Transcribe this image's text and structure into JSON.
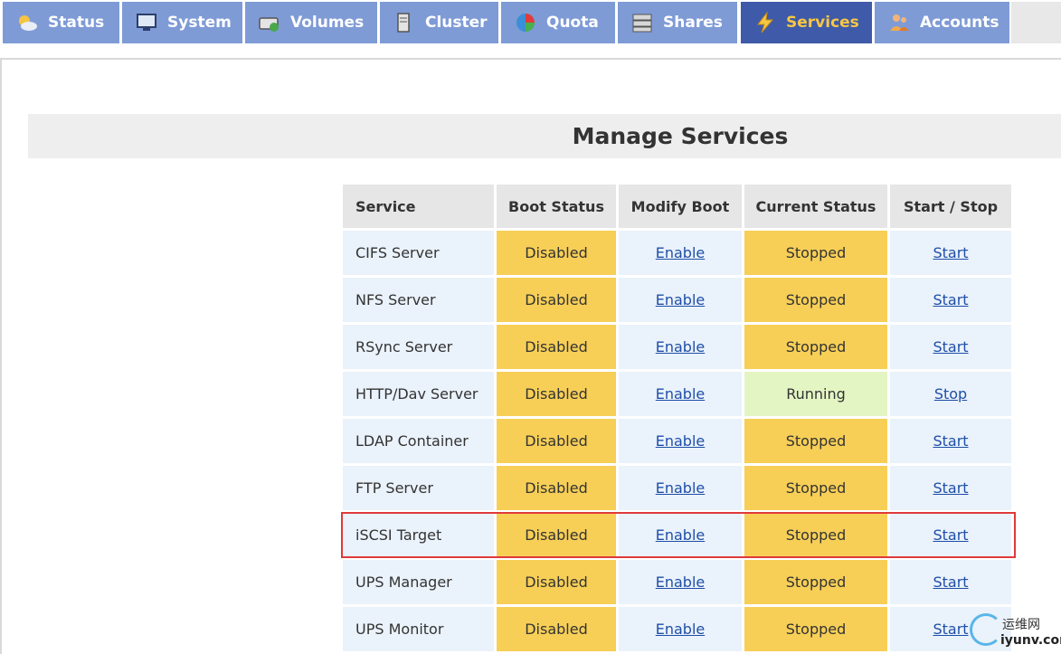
{
  "nav": {
    "tabs": [
      {
        "label": "Status",
        "icon": "weather-sun-icon"
      },
      {
        "label": "System",
        "icon": "monitor-icon"
      },
      {
        "label": "Volumes",
        "icon": "drive-icon"
      },
      {
        "label": "Cluster",
        "icon": "server-icon"
      },
      {
        "label": "Quota",
        "icon": "pie-chart-icon"
      },
      {
        "label": "Shares",
        "icon": "storage-icon"
      },
      {
        "label": "Services",
        "icon": "lightning-icon",
        "active": true
      },
      {
        "label": "Accounts",
        "icon": "users-icon"
      }
    ]
  },
  "page": {
    "title": "Manage Services"
  },
  "table": {
    "headers": [
      "Service",
      "Boot Status",
      "Modify Boot",
      "Current Status",
      "Start / Stop"
    ],
    "rows": [
      {
        "service": "CIFS Server",
        "boot": "Disabled",
        "modify": "Enable",
        "current": "Stopped",
        "action": "Start"
      },
      {
        "service": "NFS Server",
        "boot": "Disabled",
        "modify": "Enable",
        "current": "Stopped",
        "action": "Start"
      },
      {
        "service": "RSync Server",
        "boot": "Disabled",
        "modify": "Enable",
        "current": "Stopped",
        "action": "Start"
      },
      {
        "service": "HTTP/Dav Server",
        "boot": "Disabled",
        "modify": "Enable",
        "current": "Running",
        "action": "Stop"
      },
      {
        "service": "LDAP Container",
        "boot": "Disabled",
        "modify": "Enable",
        "current": "Stopped",
        "action": "Start"
      },
      {
        "service": "FTP Server",
        "boot": "Disabled",
        "modify": "Enable",
        "current": "Stopped",
        "action": "Start"
      },
      {
        "service": "iSCSI Target",
        "boot": "Disabled",
        "modify": "Enable",
        "current": "Stopped",
        "action": "Start",
        "highlighted": true
      },
      {
        "service": "UPS Manager",
        "boot": "Disabled",
        "modify": "Enable",
        "current": "Stopped",
        "action": "Start"
      },
      {
        "service": "UPS Monitor",
        "boot": "Disabled",
        "modify": "Enable",
        "current": "Stopped",
        "action": "Start"
      }
    ]
  },
  "colors": {
    "nav_bg": "#7f9bd6",
    "nav_active_bg": "#3f5aa8",
    "nav_active_text": "#f7c744",
    "status_disabled": "#f7cf57",
    "status_running": "#e4f5c4",
    "cell_bg": "#eaf2fb",
    "highlight": "#e03a3a"
  },
  "watermark": {
    "cn": "运维网",
    "en": "iyunv.com"
  }
}
